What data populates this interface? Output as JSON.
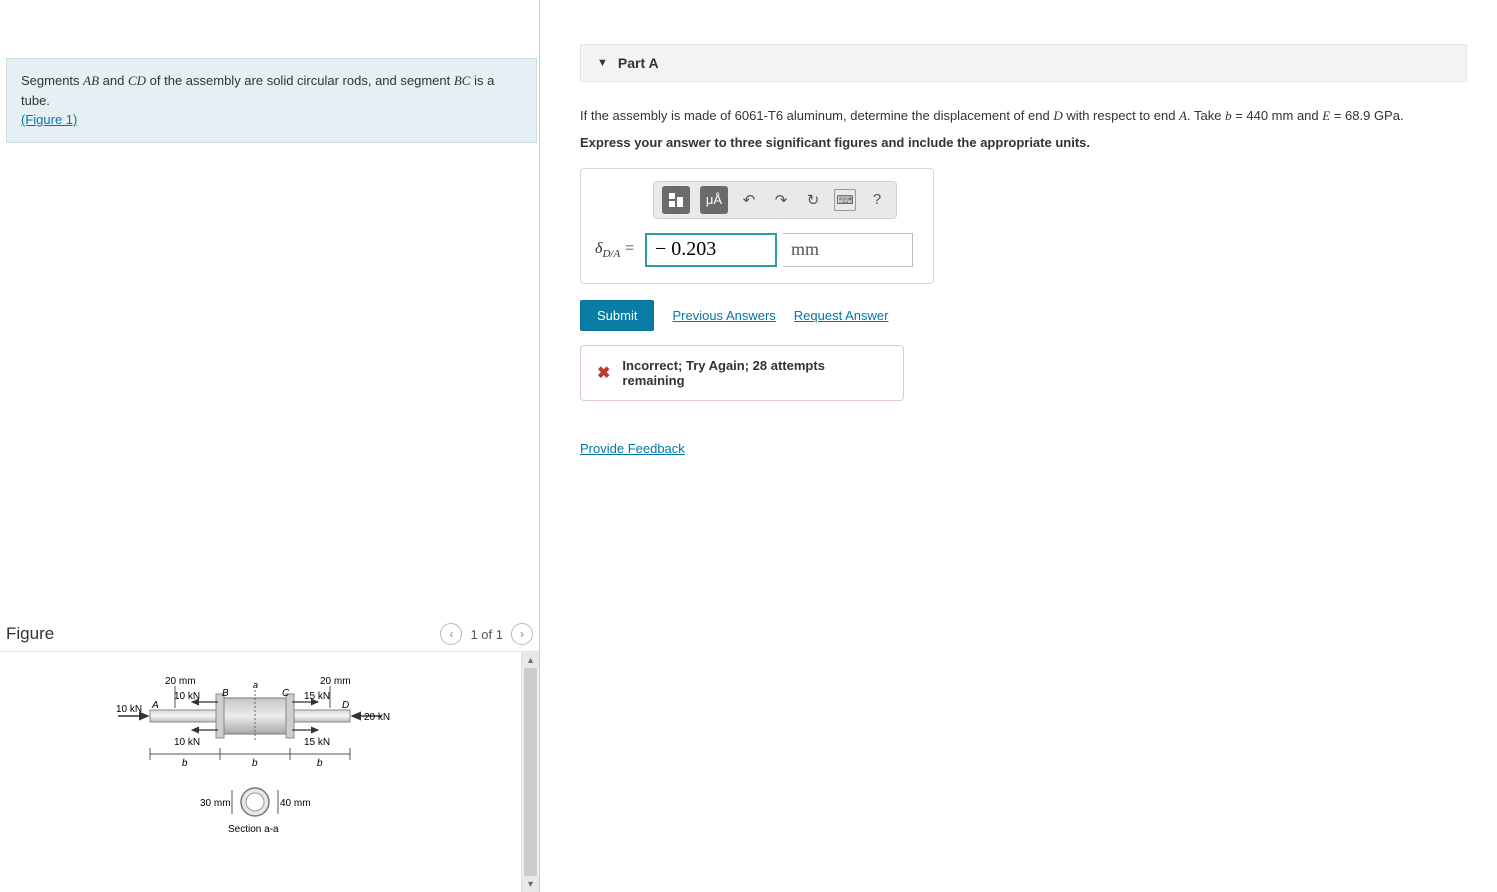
{
  "left": {
    "intro_1": "Segments ",
    "ab": "AB",
    "intro_2": " and ",
    "cd": "CD",
    "intro_3": " of the assembly are solid circular rods, and segment ",
    "bc": "BC",
    "intro_4": " is a tube.",
    "figure_link": "(Figure 1)"
  },
  "figure": {
    "title": "Figure",
    "nav_prev": "‹",
    "nav_label": "1 of 1",
    "nav_next": "›",
    "labels": {
      "d20_left": "20 mm",
      "d20_right": "20 mm",
      "f10_top": "10 kN",
      "f10_left": "10 kN",
      "f10_bot": "10 kN",
      "f15_top": "15 kN",
      "f15_bot": "15 kN",
      "f20": "20 kN",
      "A": "A",
      "B": "B",
      "C": "C",
      "D": "D",
      "a_cut": "a",
      "b1": "b",
      "b2": "b",
      "b3": "b",
      "d30": "30 mm",
      "d40": "40 mm",
      "section": "Section a-a"
    }
  },
  "part": {
    "header": "Part A",
    "q1": "If the assembly is made of 6061-T6 aluminum, determine the displacement of end ",
    "D": "D",
    "q2": " with respect to end ",
    "A": "A",
    "q3": ". Take ",
    "bvar": "b",
    "beq": " = 440   mm and ",
    "Evar": "E",
    "Eeq": " = 68.9 GPa.",
    "instruct": "Express your answer to three significant figures and include the appropriate units."
  },
  "toolbar": {
    "templates": "▭",
    "units": "μÅ",
    "undo": "↶",
    "redo": "↷",
    "reset": "↻",
    "keyboard": "⌨",
    "help": "?"
  },
  "answer": {
    "lhs_delta": "δ",
    "lhs_sub": "D/A",
    "eq": " = ",
    "value": "− 0.203",
    "unit": "mm"
  },
  "actions": {
    "submit": "Submit",
    "previous": "Previous Answers",
    "request": "Request Answer"
  },
  "feedback": {
    "icon": "✖",
    "text": "Incorrect; Try Again; 28 attempts remaining"
  },
  "provide_feedback": "Provide Feedback"
}
